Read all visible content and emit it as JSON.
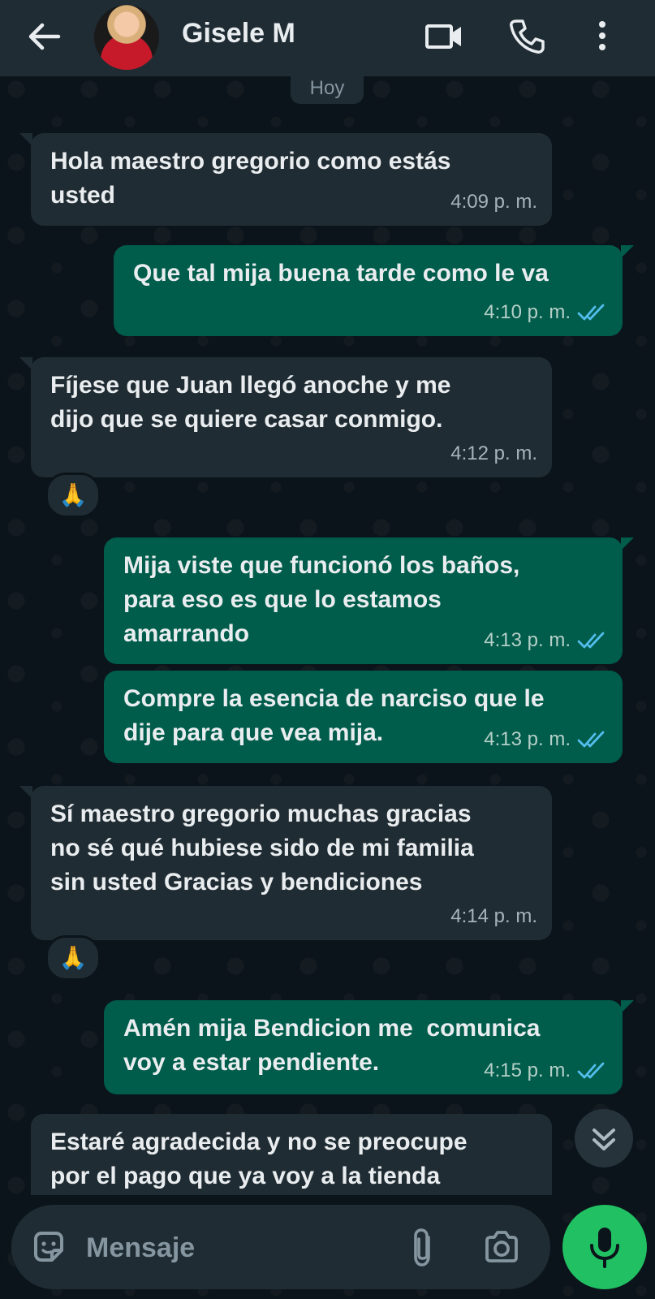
{
  "header": {
    "contact_name": "Gisele M",
    "icons": [
      "back-arrow-icon",
      "video-call-icon",
      "voice-call-icon",
      "more-options-icon"
    ]
  },
  "date_label": "Hoy",
  "messages": [
    {
      "direction": "in",
      "text_lines": [
        "Hola maestro gregorio como estás",
        "usted"
      ],
      "time": "4:09 p. m."
    },
    {
      "direction": "out",
      "text_lines": [
        "Que tal mija buena tarde como le va"
      ],
      "time": "4:10 p. m.",
      "status": "read"
    },
    {
      "direction": "in",
      "text_lines": [
        "Fíjese que Juan llegó anoche y me",
        "dijo que se quiere casar conmigo."
      ],
      "time": "4:12 p. m.",
      "reaction": "🙏"
    },
    {
      "direction": "out",
      "text_lines": [
        "Mija viste que funcionó los baños,",
        "para eso es que lo estamos",
        "amarrando"
      ],
      "time": "4:13 p. m.",
      "status": "read"
    },
    {
      "direction": "out",
      "text_lines": [
        "Compre la esencia de narciso que le",
        "dije para que vea mija."
      ],
      "time": "4:13 p. m.",
      "status": "read"
    },
    {
      "direction": "in",
      "text_lines": [
        "Sí maestro gregorio muchas gracias",
        "no sé qué hubiese sido de mi familia",
        "sin usted Gracias y bendiciones"
      ],
      "time": "4:14 p. m.",
      "reaction": "🙏"
    },
    {
      "direction": "out",
      "text_lines": [
        "Amén mija Bendicion me  comunica",
        "voy a estar pendiente."
      ],
      "time": "4:15 p. m.",
      "status": "read"
    },
    {
      "direction": "in",
      "text_lines": [
        "Estaré agradecida y no se preocupe",
        "por el pago que ya voy a la tienda"
      ],
      "time": ""
    }
  ],
  "composer": {
    "placeholder": "Mensaje",
    "icons": [
      "emoji-sticker-icon",
      "attach-icon",
      "camera-icon",
      "microphone-icon"
    ]
  },
  "colors": {
    "background": "#0b141a",
    "header": "#1f2c34",
    "incoming_bubble": "#202c33",
    "outgoing_bubble": "#005c4b",
    "read_ticks": "#53bdeb",
    "mic_button": "#21c063"
  }
}
